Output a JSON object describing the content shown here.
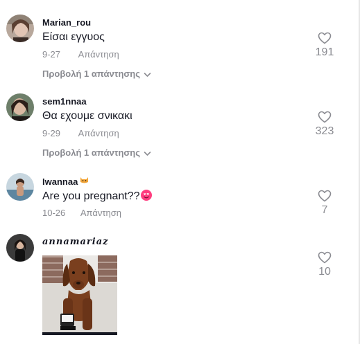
{
  "comments": [
    {
      "username": "Marian_rou",
      "text": "Είσαι εγγυος",
      "date": "9-27",
      "reply_label": "Απάντηση",
      "replies_label": "Προβολή 1 απάντησης",
      "likes": "191"
    },
    {
      "username": "sem1nnaa",
      "text": "Θα εχουμε σνικακι",
      "date": "9-29",
      "reply_label": "Απάντηση",
      "replies_label": "Προβολή 1 απάντησης",
      "likes": "323"
    },
    {
      "username": "Iwannaa",
      "text": "Are you pregnant??",
      "date": "10-26",
      "reply_label": "Απάντηση",
      "likes": "7",
      "badge_icon": "cat-emoji",
      "text_emoji": "heart-eyes-emoji"
    },
    {
      "username": "annamariaz",
      "likes": "10",
      "image": "dachshund-photo"
    }
  ],
  "colors": {
    "primary_text": "#161823",
    "secondary_text": "#8a8b91",
    "icon_stroke": "#8a8b91"
  },
  "icons": {
    "like": "heart-outline-icon",
    "expand": "chevron-down-icon"
  }
}
